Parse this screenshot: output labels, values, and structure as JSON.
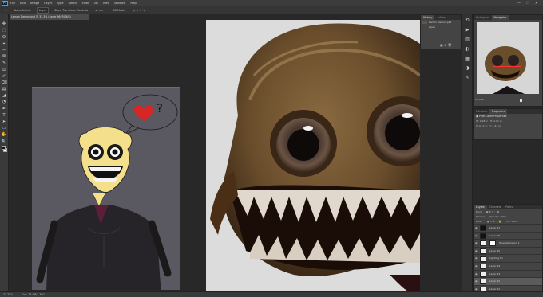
{
  "menubar": {
    "logo": "Ps",
    "items": [
      "File",
      "Edit",
      "Image",
      "Layer",
      "Type",
      "Select",
      "Filter",
      "3D",
      "View",
      "Window",
      "Help"
    ],
    "win_controls": [
      "—",
      "❐",
      "✕"
    ]
  },
  "options": {
    "items": [
      "Auto-Select:",
      "Layer",
      "Show Transform Controls",
      "3D Mode:"
    ]
  },
  "document_tab": "Lemon Demon.psd @ 33.3% (Layer 96, RGB/8)",
  "tools": [
    "✥",
    "⬚",
    "ʘ",
    "⌖",
    "✂",
    "⊠",
    "✎",
    "⎚",
    "✐",
    "⌫",
    "▤",
    "◢",
    "◔",
    "✒",
    "T",
    "➤",
    "▭",
    "✋",
    "🔍",
    "⋯"
  ],
  "history_panel": {
    "tabs": [
      "History",
      "Actions"
    ],
    "rows": [
      "Lemon Demon.psd",
      "Open"
    ]
  },
  "navigator_panel": {
    "tabs": [
      "Histogram",
      "Navigator"
    ],
    "zoom": "33.33%"
  },
  "properties_panel": {
    "tabs": [
      "Libraries",
      "Properties"
    ],
    "title": "Pixel Layer Properties",
    "fields": [
      "W: 2.28 in",
      "H: 2.81 in",
      "X: 0.11 in",
      "Y: 1.44 in"
    ]
  },
  "layers_panel": {
    "tabs": [
      "Layers",
      "Channels",
      "Paths"
    ],
    "kind": "Kind",
    "blend_mode": "Normal",
    "opacity": "Opacity: 100%",
    "lock": "Lock:",
    "fill": "Fill: 100%",
    "layers": [
      {
        "name": "Layer 97",
        "dark": true,
        "mask": false,
        "selected": false
      },
      {
        "name": "Layer 96",
        "dark": true,
        "mask": false,
        "selected": false
      },
      {
        "name": "Hue/Saturation 1",
        "dark": false,
        "mask": true,
        "selected": false
      },
      {
        "name": "Layer 95",
        "dark": false,
        "mask": false,
        "selected": false
      },
      {
        "name": "Lighting fix",
        "dark": false,
        "mask": false,
        "selected": false
      },
      {
        "name": "Layer 94",
        "dark": false,
        "mask": false,
        "selected": false
      },
      {
        "name": "Layer 93",
        "dark": false,
        "mask": false,
        "selected": false
      },
      {
        "name": "Layer 92",
        "dark": false,
        "mask": false,
        "selected": true
      },
      {
        "name": "Layer 91",
        "dark": false,
        "mask": false,
        "selected": false
      }
    ]
  },
  "statusbar": {
    "zoom": "33.33%",
    "doc": "Doc: 24.9M/1.36G"
  },
  "colors": {
    "accent": "#31a8ff",
    "nav_rect": "#ff3333",
    "heart": "#d62626"
  }
}
